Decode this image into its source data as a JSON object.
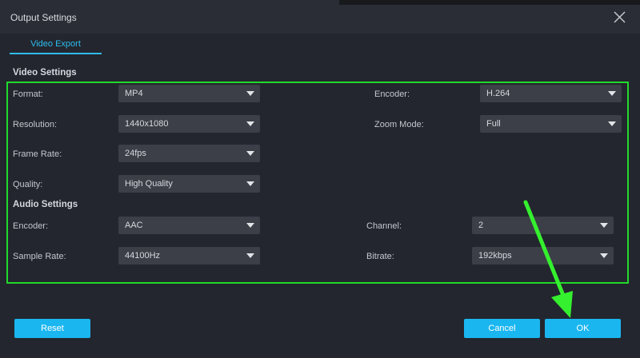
{
  "window": {
    "title": "Output Settings"
  },
  "tabs": [
    {
      "label": "Video Export"
    }
  ],
  "video_settings": {
    "title": "Video Settings",
    "format": {
      "label": "Format:",
      "value": "MP4"
    },
    "encoder": {
      "label": "Encoder:",
      "value": "H.264"
    },
    "resolution": {
      "label": "Resolution:",
      "value": "1440x1080"
    },
    "zoom_mode": {
      "label": "Zoom Mode:",
      "value": "Full"
    },
    "frame_rate": {
      "label": "Frame Rate:",
      "value": "24fps"
    },
    "quality": {
      "label": "Quality:",
      "value": "High Quality"
    }
  },
  "audio_settings": {
    "title": "Audio Settings",
    "encoder": {
      "label": "Encoder:",
      "value": "AAC"
    },
    "channel": {
      "label": "Channel:",
      "value": "2"
    },
    "sample_rate": {
      "label": "Sample Rate:",
      "value": "44100Hz"
    },
    "bitrate": {
      "label": "Bitrate:",
      "value": "192kbps"
    }
  },
  "buttons": {
    "reset": "Reset",
    "cancel": "Cancel",
    "ok": "OK"
  },
  "colors": {
    "accent": "#1ab6ef",
    "highlight": "#22d82c",
    "background": "#23262e"
  },
  "icons": {
    "close": "close-icon",
    "dropdown": "chevron-down-icon",
    "annotation": "arrow-annotation"
  }
}
